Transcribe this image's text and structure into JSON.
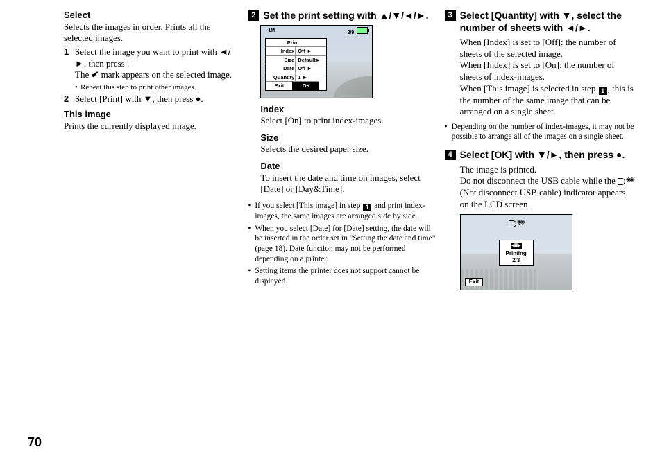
{
  "page_number": "70",
  "col1": {
    "h_select": "Select",
    "p_select_desc": "Selects the images in order. Prints all the selected images.",
    "li1_a": "Select the image you want to print with ",
    "li1_arrows": "◄/►",
    "li1_b": ", then press ",
    "li1_dot": "●",
    "li1_c": ".",
    "li1_d": "The ",
    "li1_check": "✔",
    "li1_e": " mark appears on the selected image.",
    "li1_sub": "Repeat this step to print other images.",
    "li2_a": "Select [Print] with ",
    "li2_dn": "▼",
    "li2_b": ", then press ",
    "li2_dot": "●",
    "li2_c": ".",
    "h_this": "This image",
    "p_this": "Prints the currently displayed image."
  },
  "col2": {
    "step_num": "2",
    "step_a": "Set the print setting with ",
    "step_arrows": "▲/▼/◄/►",
    "step_b": ".",
    "scr": {
      "topL": "1M",
      "topR": "2/9",
      "hd": "Print",
      "r_index_l": "Index",
      "r_index_v": "Off ►",
      "r_size_l": "Size",
      "r_size_v": "Default►",
      "r_date_l": "Date",
      "r_date_v": "Off ►",
      "r_qty_l": "Quantity",
      "r_qty_v": "1 ►",
      "ft_exit": "Exit",
      "ft_ok": "OK"
    },
    "h_index": "Index",
    "p_index": "Select [On] to print index-images.",
    "h_size": "Size",
    "p_size": "Selects the desired paper size.",
    "h_date": "Date",
    "p_date": "To insert the date and time on images, select [Date] or [Day&Time].",
    "bul1_a": "If you select [This image] in step ",
    "bul1_box": "1",
    "bul1_b": " and print index-images, the same images are arranged side by side.",
    "bul2": "When you select [Date] for [Date] setting, the date will be inserted in the order set in \"Setting the date and time\" (page 18). Date function may not be performed depending on a printer.",
    "bul3": "Setting items the printer does not support cannot be displayed."
  },
  "col3": {
    "s3_num": "3",
    "s3_a": "Select [Quantity] with ",
    "s3_dn": "▼",
    "s3_b": ", select the number of sheets with ",
    "s3_lr": "◄/►",
    "s3_c": ".",
    "p3a": "When [Index] is set to [Off]: the number of sheets of the selected image.",
    "p3b": "When [Index] is set to [On]: the number of sheets of index-images.",
    "p3c_a": "When [This image] is selected in step ",
    "p3c_box": "1",
    "p3c_b": ", this is the number of the same image that can be arranged on a single sheet.",
    "bul": "Depending on the number of index-images, it may not be possible to arrange all of the images on a single sheet.",
    "s4_num": "4",
    "s4_a": "Select [OK] with ",
    "s4_dr": "▼/►",
    "s4_b": ", then press ",
    "s4_dot": "●",
    "s4_c": ".",
    "p4a": "The image is printed.",
    "p4b_a": "Do not disconnect the USB cable while the ",
    "p4b_b": " (Not disconnect USB cable) indicator appears on the LCD screen.",
    "scr2": {
      "bar": "◂▣▸",
      "printing": "Printing",
      "count": "2/3",
      "exit": "Exit"
    }
  }
}
